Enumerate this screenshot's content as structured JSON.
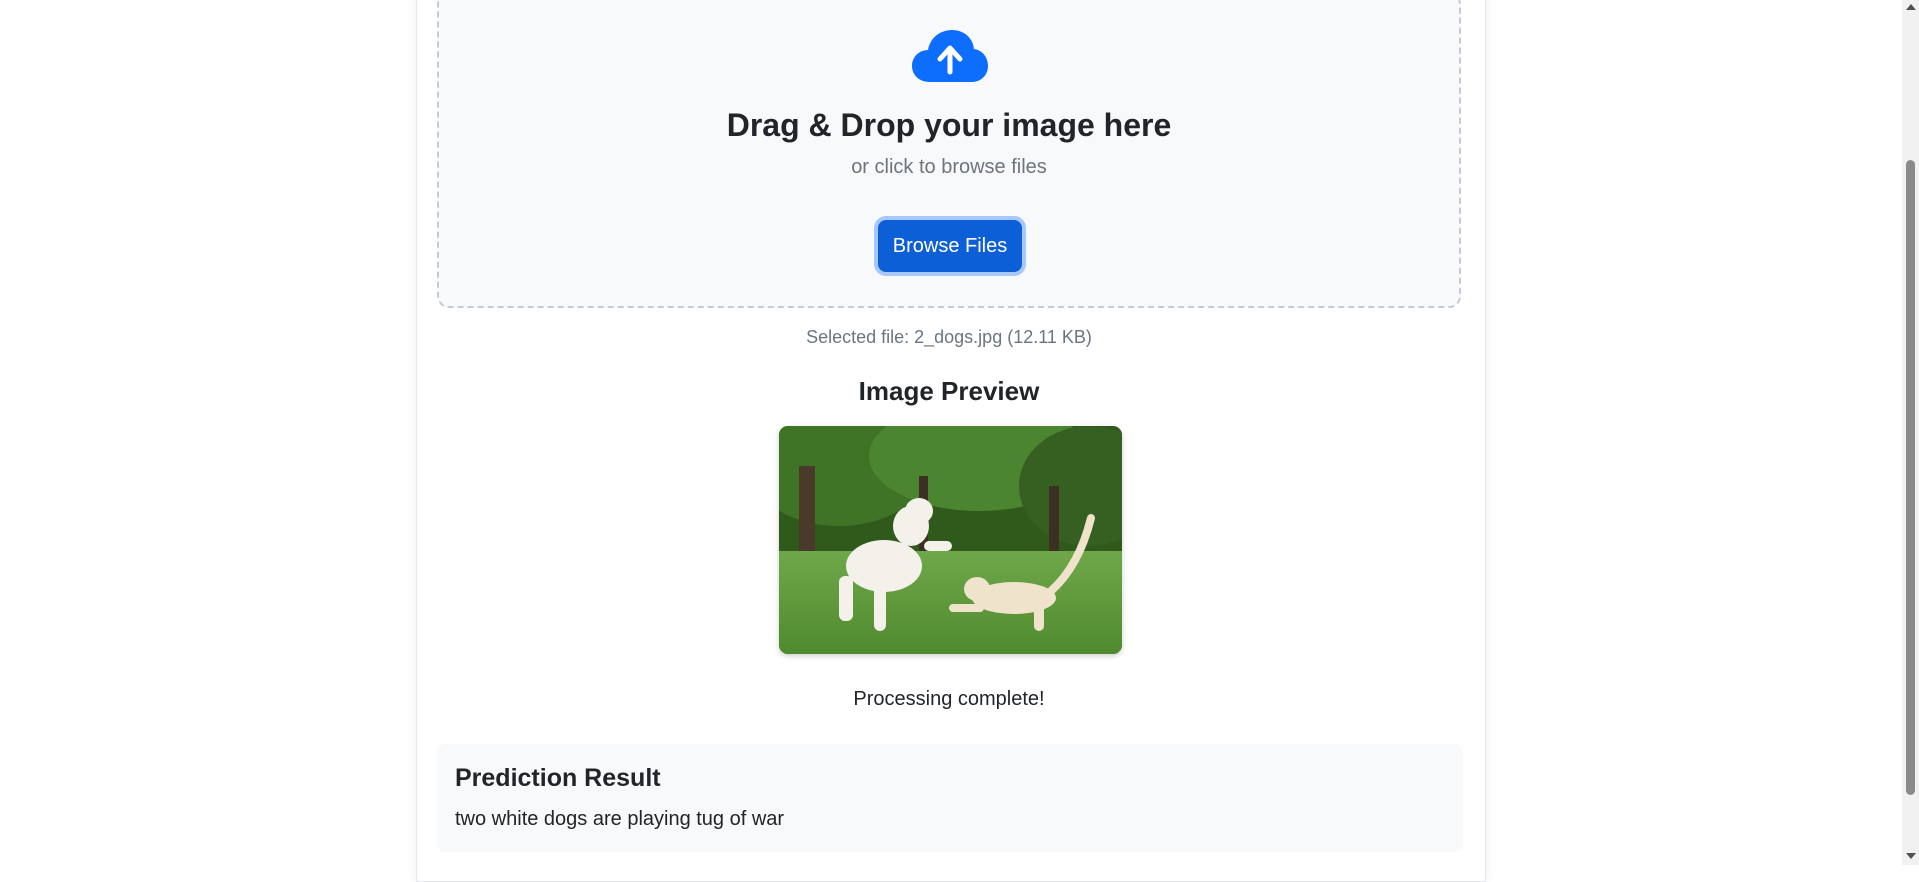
{
  "upload": {
    "title": "Drag & Drop your image here",
    "subtitle": "or click to browse files",
    "browse_label": "Browse Files",
    "icon": "cloud-upload-icon"
  },
  "selected_file": "Selected file: 2_dogs.jpg (12.11 KB)",
  "preview": {
    "title": "Image Preview"
  },
  "status": "Processing complete!",
  "result": {
    "title": "Prediction Result",
    "text": "two white dogs are playing tug of war"
  },
  "colors": {
    "accent": "#0d6efd",
    "muted": "#6c757d",
    "panel": "#f8f9fa"
  }
}
